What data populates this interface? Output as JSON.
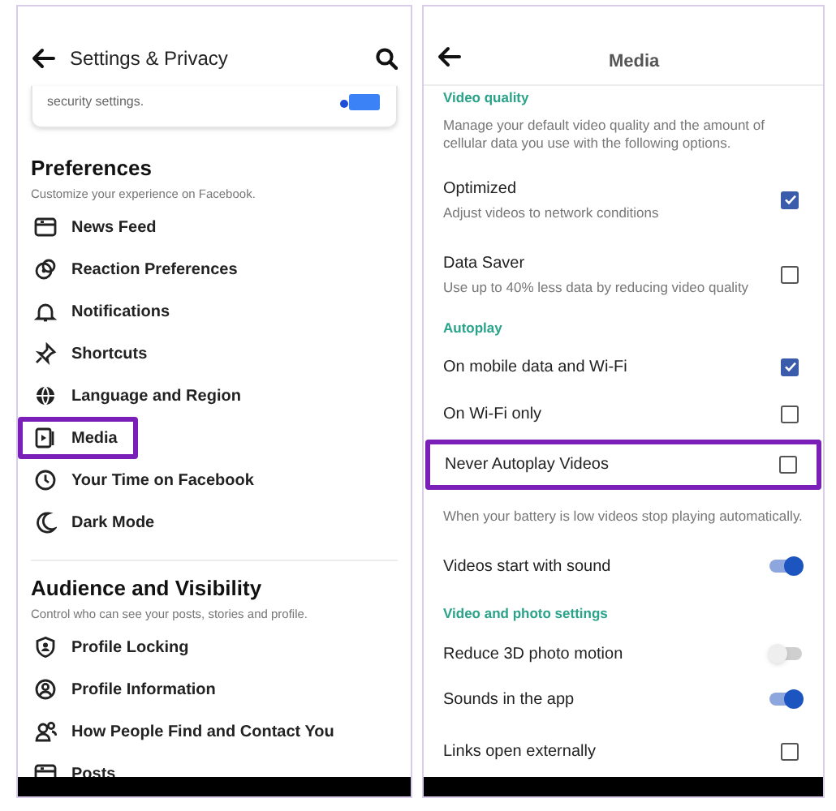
{
  "left": {
    "title": "Settings & Privacy",
    "card_text": "security settings.",
    "sections": [
      {
        "title": "Preferences",
        "subtitle": "Customize your experience on Facebook.",
        "items": [
          {
            "label": "News Feed",
            "highlighted": false
          },
          {
            "label": "Reaction Preferences",
            "highlighted": false
          },
          {
            "label": "Notifications",
            "highlighted": false
          },
          {
            "label": "Shortcuts",
            "highlighted": false
          },
          {
            "label": "Language and Region",
            "highlighted": false
          },
          {
            "label": "Media",
            "highlighted": true
          },
          {
            "label": "Your Time on Facebook",
            "highlighted": false
          },
          {
            "label": "Dark Mode",
            "highlighted": false
          }
        ]
      },
      {
        "title": "Audience and Visibility",
        "subtitle": "Control who can see your posts, stories and profile.",
        "items": [
          {
            "label": "Profile Locking",
            "highlighted": false
          },
          {
            "label": "Profile Information",
            "highlighted": false
          },
          {
            "label": "How People Find and Contact You",
            "highlighted": false
          },
          {
            "label": "Posts",
            "highlighted": false
          }
        ]
      }
    ]
  },
  "right": {
    "title": "Media",
    "rows": [
      {
        "kind": "section",
        "label": "Video quality"
      },
      {
        "kind": "note",
        "label": "Manage your default video quality and the amount of cellular data you use with the following options."
      },
      {
        "kind": "checkbox",
        "label": "Optimized",
        "sublabel": "Adjust videos to network conditions",
        "checked": true,
        "highlighted": false
      },
      {
        "kind": "checkbox",
        "label": "Data Saver",
        "sublabel": "Use up to 40% less data by reducing video quality",
        "checked": false,
        "highlighted": false
      },
      {
        "kind": "section",
        "label": "Autoplay"
      },
      {
        "kind": "checkbox",
        "label": "On mobile data and Wi-Fi",
        "checked": true,
        "highlighted": false
      },
      {
        "kind": "checkbox",
        "label": "On Wi-Fi only",
        "checked": false,
        "highlighted": false
      },
      {
        "kind": "checkbox",
        "label": "Never Autoplay Videos",
        "checked": false,
        "highlighted": true
      },
      {
        "kind": "note",
        "label": "When your battery is low videos stop playing automatically."
      },
      {
        "kind": "toggle",
        "label": "Videos start with sound",
        "on": true
      },
      {
        "kind": "section",
        "label": "Video and photo settings"
      },
      {
        "kind": "toggle",
        "label": "Reduce 3D photo motion",
        "on": false
      },
      {
        "kind": "toggle",
        "label": "Sounds in the app",
        "on": true
      },
      {
        "kind": "checkbox",
        "label": "Links open externally",
        "checked": false,
        "highlighted": false
      }
    ]
  }
}
